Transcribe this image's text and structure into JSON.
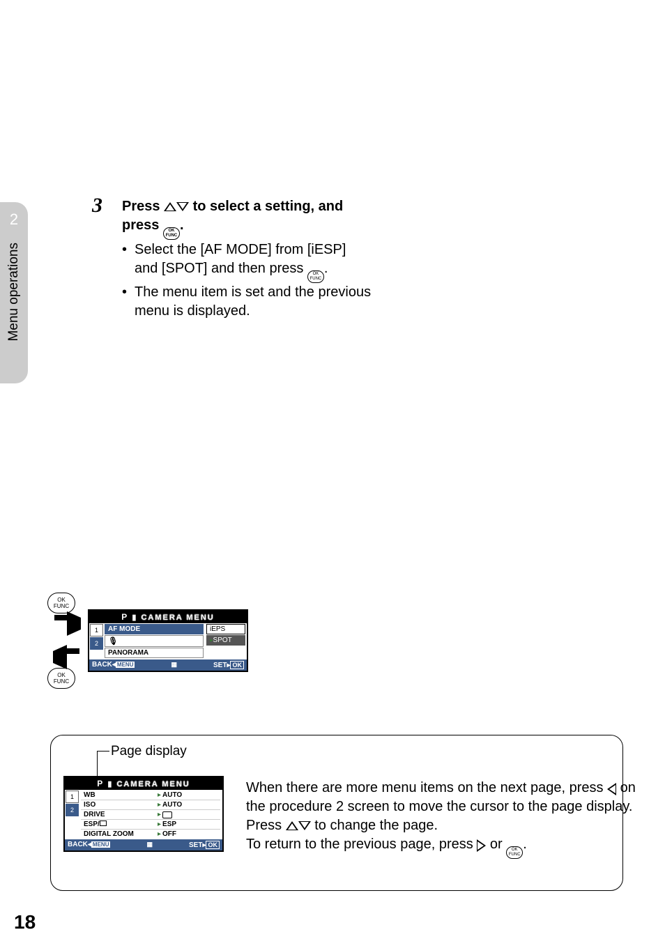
{
  "sidebar": {
    "chapter_number": "2",
    "chapter_title": "Menu operations"
  },
  "step": {
    "number": "3",
    "title_prefix": "Press ",
    "title_mid": " to select a setting, and press ",
    "title_suffix": ".",
    "bullet1a": "Select the [AF MODE] from [iESP] and [SPOT] and then press ",
    "bullet1b": ".",
    "bullet2": "The menu item is set and the previous menu is displayed."
  },
  "okfunc": {
    "top": "OK",
    "bottom": "FUNC"
  },
  "screen1": {
    "mode": "P",
    "title": "CAMERA MENU",
    "tabs": [
      "1",
      "2"
    ],
    "items_left": [
      "AF MODE",
      "",
      "PANORAMA"
    ],
    "mic_label": "",
    "items_right": [
      "iEPS",
      "SPOT"
    ],
    "footer_back": "BACK",
    "footer_menu": "MENU",
    "footer_set": "SET",
    "footer_ok": "OK"
  },
  "note": {
    "page_display_label": "Page display",
    "text_line1": "When there are more menu items on the next page, press ",
    "text_line1b": " on the procedure 2 screen to move the cursor to the page display.",
    "text_line2": "Press ",
    "text_line2b": " to change the page.",
    "text_line3": "To return to the previous page, press ",
    "text_line3b": " or ",
    "text_line3c": "."
  },
  "screen2": {
    "mode": "P",
    "title": "CAMERA MENU",
    "tabs": [
      "1",
      "2"
    ],
    "rows": [
      {
        "label": "WB",
        "value": "AUTO"
      },
      {
        "label": "ISO",
        "value": "AUTO"
      },
      {
        "label": "DRIVE",
        "value": ""
      },
      {
        "label": "ESP/",
        "value": "ESP"
      },
      {
        "label": "DIGITAL ZOOM",
        "value": "OFF"
      }
    ],
    "footer_back": "BACK",
    "footer_menu": "MENU",
    "footer_set": "SET",
    "footer_ok": "OK"
  },
  "page_number": "18"
}
